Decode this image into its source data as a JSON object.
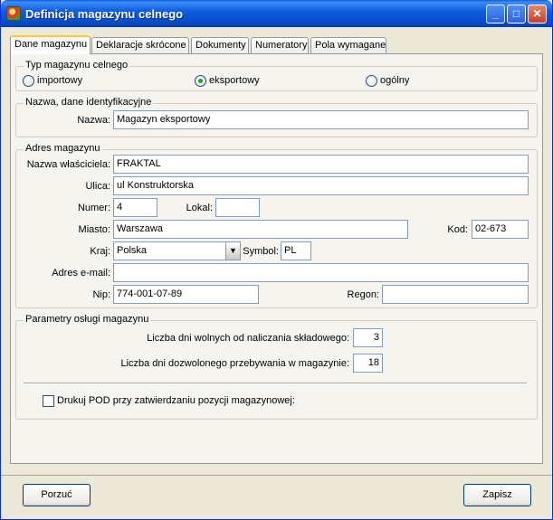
{
  "window": {
    "title": "Definicja magazynu celnego"
  },
  "tabs": [
    {
      "label": "Dane magazynu"
    },
    {
      "label": "Deklaracje skrócone"
    },
    {
      "label": "Dokumenty"
    },
    {
      "label": "Numeratory"
    },
    {
      "label": "Pola wymagane"
    }
  ],
  "type_group": {
    "title": "Typ magazynu celnego",
    "options": [
      {
        "label": "importowy",
        "selected": false
      },
      {
        "label": "eksportowy",
        "selected": true
      },
      {
        "label": "ogólny",
        "selected": false
      }
    ]
  },
  "name_group": {
    "title": "Nazwa, dane identyfikacyjne",
    "name_label": "Nazwa:",
    "name_value": "Magazyn eksportowy"
  },
  "address_group": {
    "title": "Adres magazynu",
    "owner_label": "Nazwa właściciela:",
    "owner_value": "FRAKTAL",
    "street_label": "Ulica:",
    "street_value": "ul Konstruktorska",
    "number_label": "Numer:",
    "number_value": "4",
    "local_label": "Lokal:",
    "local_value": "",
    "city_label": "Miasto:",
    "city_value": "Warszawa",
    "postcode_label": "Kod:",
    "postcode_value": "02-673",
    "country_label": "Kraj:",
    "country_value": "Polska",
    "symbol_label": "Symbol:",
    "symbol_value": "PL",
    "email_label": "Adres e-mail:",
    "email_value": "",
    "nip_label": "Nip:",
    "nip_value": "774-001-07-89",
    "regon_label": "Regon:",
    "regon_value": ""
  },
  "params_group": {
    "title": "Parametry osługi magazynu",
    "free_days_label": "Liczba dni wolnych od naliczania składowego:",
    "free_days_value": "3",
    "allowed_days_label": "Liczba dni dozwolonego przebywania w magazynie:",
    "allowed_days_value": "18",
    "print_pod_label": "Drukuj POD przy zatwierdzaniu pozycji magazynowej:",
    "print_pod_checked": false
  },
  "buttons": {
    "cancel": "Porzuć",
    "save": "Zapisz"
  },
  "colors": {
    "titlebar": "#0847c8",
    "window_bg": "#ece9d8",
    "radio_dot": "#21a121",
    "active_tab_accent": "#ffc83c"
  }
}
